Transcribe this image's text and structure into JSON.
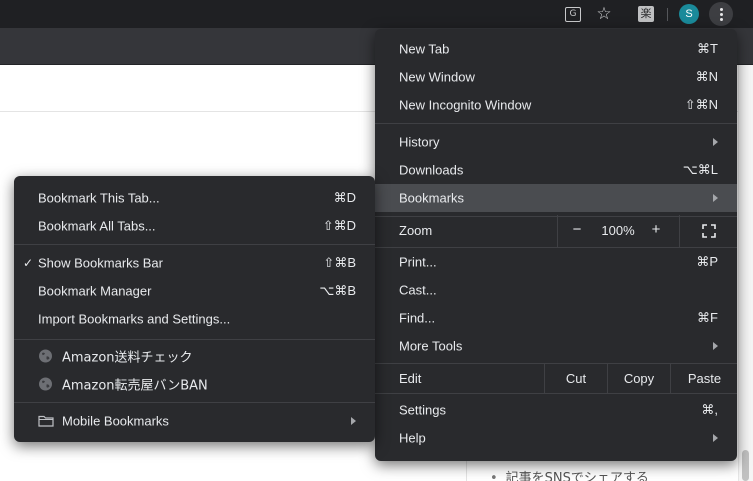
{
  "browser": {
    "profile_initial": "S",
    "extension_glyph": "楽",
    "translate_glyph": "G"
  },
  "page": {
    "visible_text": "記事をSNSでシェアする"
  },
  "main_menu": {
    "new_tab": {
      "label": "New Tab",
      "shortcut": "⌘T"
    },
    "new_window": {
      "label": "New Window",
      "shortcut": "⌘N"
    },
    "new_incognito": {
      "label": "New Incognito Window",
      "shortcut": "⇧⌘N"
    },
    "history": {
      "label": "History"
    },
    "downloads": {
      "label": "Downloads",
      "shortcut": "⌥⌘L"
    },
    "bookmarks": {
      "label": "Bookmarks"
    },
    "zoom": {
      "label": "Zoom",
      "minus": "−",
      "level": "100%",
      "plus": "+"
    },
    "print": {
      "label": "Print...",
      "shortcut": "⌘P"
    },
    "cast": {
      "label": "Cast..."
    },
    "find": {
      "label": "Find...",
      "shortcut": "⌘F"
    },
    "more_tools": {
      "label": "More Tools"
    },
    "edit": {
      "label": "Edit",
      "cut": "Cut",
      "copy": "Copy",
      "paste": "Paste"
    },
    "settings": {
      "label": "Settings",
      "shortcut": "⌘,"
    },
    "help": {
      "label": "Help"
    }
  },
  "bookmarks_menu": {
    "bookmark_tab": {
      "label": "Bookmark This Tab...",
      "shortcut": "⌘D"
    },
    "bookmark_all": {
      "label": "Bookmark All Tabs...",
      "shortcut": "⇧⌘D"
    },
    "show_bar": {
      "label": "Show Bookmarks Bar",
      "shortcut": "⇧⌘B",
      "checked": true,
      "check": "✓"
    },
    "manager": {
      "label": "Bookmark Manager",
      "shortcut": "⌥⌘B"
    },
    "import": {
      "label": "Import Bookmarks and Settings..."
    },
    "items": [
      {
        "label": "Amazon送料チェック",
        "icon": "globe-icon"
      },
      {
        "label": "Amazon転売屋バンBAN",
        "icon": "globe-icon"
      }
    ],
    "mobile": {
      "label": "Mobile Bookmarks",
      "icon": "folder-icon"
    }
  }
}
